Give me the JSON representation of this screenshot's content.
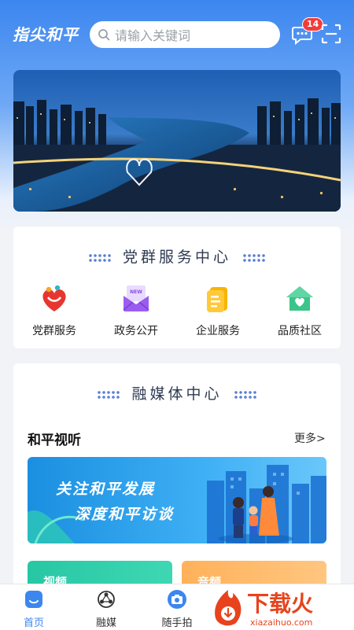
{
  "header": {
    "logo_text": "指尖和平",
    "search_placeholder": "请输入关键词",
    "message_count": "14"
  },
  "party_section": {
    "title": "党群服务中心",
    "items": [
      {
        "label": "党群服务",
        "icon": "heart-people-icon"
      },
      {
        "label": "政务公开",
        "icon": "new-envelope-icon"
      },
      {
        "label": "企业服务",
        "icon": "document-icon"
      },
      {
        "label": "品质社区",
        "icon": "home-heart-icon"
      }
    ]
  },
  "media_section": {
    "title": "融媒体中心",
    "subheading": "和平视听",
    "more_label": "更多>",
    "promo_line1": "关注和平发展",
    "promo_line2": "深度和平访谈",
    "tiles": [
      "视频",
      "音频"
    ]
  },
  "tabbar": {
    "tabs": [
      {
        "label": "首页",
        "active": true
      },
      {
        "label": "融媒"
      },
      {
        "label": "随手拍"
      }
    ]
  },
  "watermark": {
    "text_cn": "下载火",
    "text_en": "xiazaihuo.com"
  },
  "colors": {
    "primary": "#3c86f0",
    "badge": "#f23c3c",
    "watermark": "#e8431c"
  }
}
